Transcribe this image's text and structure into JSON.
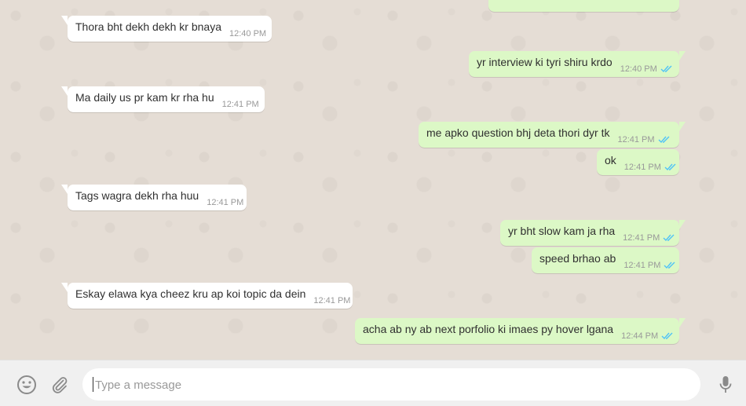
{
  "colors": {
    "chat_background": "#e5ddd5",
    "incoming_bubble": "#ffffff",
    "outgoing_bubble": "#dcf8c6",
    "read_ticks": "#4fc3f7",
    "timestamp": "#999999",
    "composer_background": "#f0f0f0"
  },
  "messages": [
    {
      "direction": "out",
      "text": "",
      "time": "",
      "status": "read"
    },
    {
      "direction": "in",
      "text": "Thora bht dekh dekh kr bnaya",
      "time": "12:40 PM"
    },
    {
      "direction": "out",
      "text": "yr interview ki tyri shiru krdo",
      "time": "12:40 PM",
      "status": "read"
    },
    {
      "direction": "in",
      "text": "Ma daily us pr kam kr rha hu",
      "time": "12:41 PM"
    },
    {
      "direction": "out",
      "text": "me apko question bhj deta thori dyr tk",
      "time": "12:41 PM",
      "status": "read"
    },
    {
      "direction": "out",
      "text": "ok",
      "time": "12:41 PM",
      "status": "read"
    },
    {
      "direction": "in",
      "text": "Tags wagra dekh rha huu",
      "time": "12:41 PM"
    },
    {
      "direction": "out",
      "text": "yr bht slow kam ja rha",
      "time": "12:41 PM",
      "status": "read"
    },
    {
      "direction": "out",
      "text": "speed brhao ab",
      "time": "12:41 PM",
      "status": "read"
    },
    {
      "direction": "in",
      "text": "Eskay elawa kya cheez kru ap koi topic da dein",
      "time": "12:41 PM"
    },
    {
      "direction": "out",
      "text": "acha ab ny ab next porfolio ki imaes py hover lgana",
      "time": "12:44 PM",
      "status": "read"
    }
  ],
  "composer": {
    "placeholder": "Type a message",
    "value": "",
    "emoji_icon": "smiley-icon",
    "attach_icon": "paperclip-icon",
    "mic_icon": "microphone-icon"
  }
}
